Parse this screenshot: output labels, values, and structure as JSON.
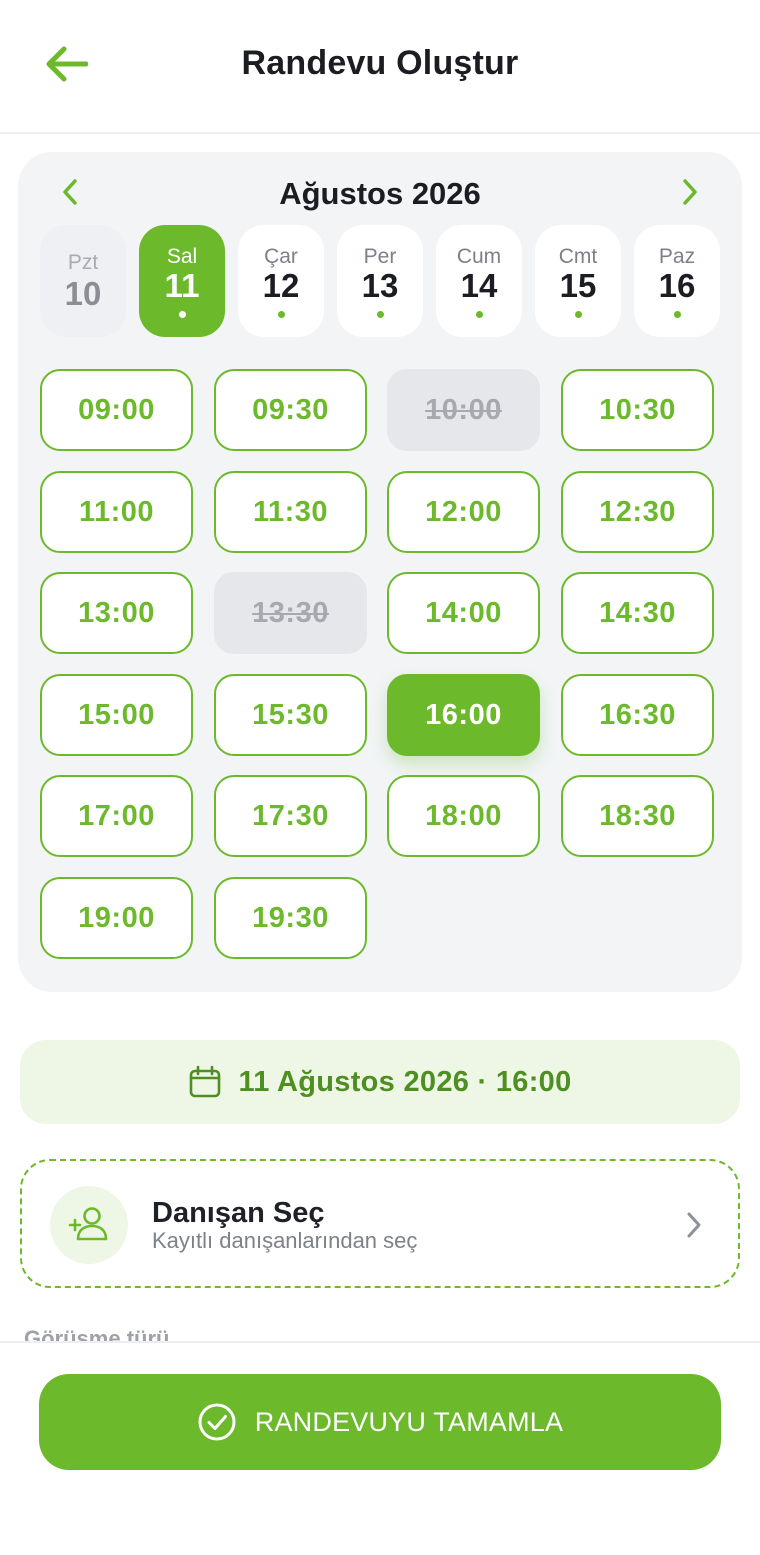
{
  "header": {
    "title": "Randevu Oluştur",
    "back_icon": "arrow-left-icon"
  },
  "calendar": {
    "month_label": "Ağustos 2026",
    "prev_icon": "chevron-left-icon",
    "next_icon": "chevron-right-icon",
    "days": [
      {
        "name": "Pzt",
        "num": "10",
        "state": "disabled",
        "has_slots": false
      },
      {
        "name": "Sal",
        "num": "11",
        "state": "selected",
        "has_slots": true
      },
      {
        "name": "Çar",
        "num": "12",
        "state": "available",
        "has_slots": true
      },
      {
        "name": "Per",
        "num": "13",
        "state": "available",
        "has_slots": true
      },
      {
        "name": "Cum",
        "num": "14",
        "state": "available",
        "has_slots": true
      },
      {
        "name": "Cmt",
        "num": "15",
        "state": "available",
        "has_slots": true
      },
      {
        "name": "Paz",
        "num": "16",
        "state": "available",
        "has_slots": true
      }
    ],
    "slots": [
      {
        "time": "09:00",
        "state": "available"
      },
      {
        "time": "09:30",
        "state": "available"
      },
      {
        "time": "10:00",
        "state": "disabled"
      },
      {
        "time": "10:30",
        "state": "available"
      },
      {
        "time": "11:00",
        "state": "available"
      },
      {
        "time": "11:30",
        "state": "available"
      },
      {
        "time": "12:00",
        "state": "available"
      },
      {
        "time": "12:30",
        "state": "available"
      },
      {
        "time": "13:00",
        "state": "available"
      },
      {
        "time": "13:30",
        "state": "disabled"
      },
      {
        "time": "14:00",
        "state": "available"
      },
      {
        "time": "14:30",
        "state": "available"
      },
      {
        "time": "15:00",
        "state": "available"
      },
      {
        "time": "15:30",
        "state": "available"
      },
      {
        "time": "16:00",
        "state": "selected"
      },
      {
        "time": "16:30",
        "state": "available"
      },
      {
        "time": "17:00",
        "state": "available"
      },
      {
        "time": "17:30",
        "state": "available"
      },
      {
        "time": "18:00",
        "state": "available"
      },
      {
        "time": "18:30",
        "state": "available"
      },
      {
        "time": "19:00",
        "state": "available"
      },
      {
        "time": "19:30",
        "state": "available"
      }
    ]
  },
  "summary": {
    "icon": "calendar-icon",
    "text": "11 Ağustos 2026 · 16:00"
  },
  "client": {
    "icon": "add-user-icon",
    "title": "Danışan Seç",
    "subtitle": "Kayıtlı danışanlarından seç",
    "chevron_icon": "chevron-right-icon"
  },
  "section": {
    "label": "Görüşme türü"
  },
  "footer": {
    "button_icon": "check-circle-icon",
    "button_label": "RANDEVUYU TAMAMLA"
  },
  "colors": {
    "accent": "#6cb92c",
    "accent_dark_text": "#4f8f22",
    "accent_light_bg": "#eef7e6",
    "card_bg": "#f2f4f6",
    "disabled_bg": "#e6e7eb"
  }
}
